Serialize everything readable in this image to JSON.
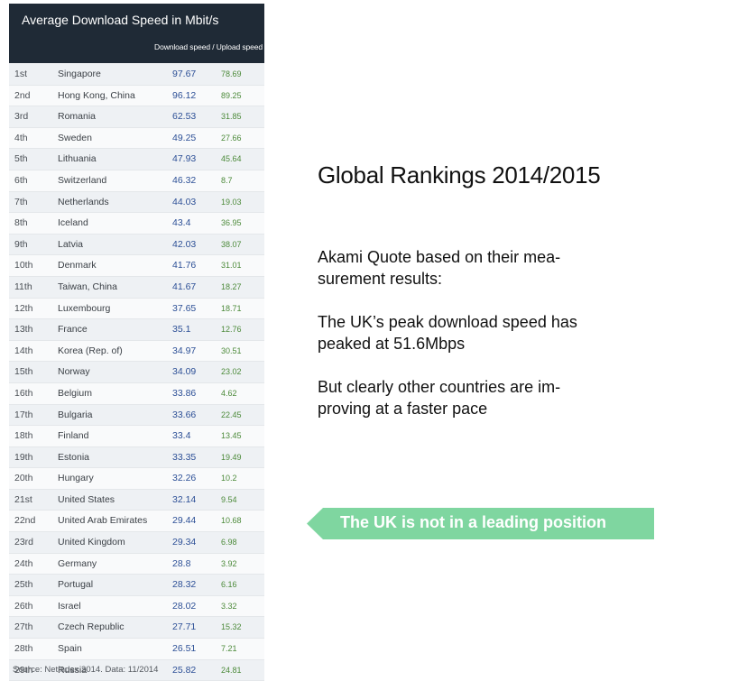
{
  "table": {
    "title": "Average Download Speed in Mbit/s",
    "column_header": "Download speed / Upload speed",
    "rows": [
      {
        "rank": "1st",
        "country": "Singapore",
        "download": "97.67",
        "upload": "78.69"
      },
      {
        "rank": "2nd",
        "country": "Hong Kong, China",
        "download": "96.12",
        "upload": "89.25"
      },
      {
        "rank": "3rd",
        "country": "Romania",
        "download": "62.53",
        "upload": "31.85"
      },
      {
        "rank": "4th",
        "country": "Sweden",
        "download": "49.25",
        "upload": "27.66"
      },
      {
        "rank": "5th",
        "country": "Lithuania",
        "download": "47.93",
        "upload": "45.64"
      },
      {
        "rank": "6th",
        "country": "Switzerland",
        "download": "46.32",
        "upload": "8.7"
      },
      {
        "rank": "7th",
        "country": "Netherlands",
        "download": "44.03",
        "upload": "19.03"
      },
      {
        "rank": "8th",
        "country": "Iceland",
        "download": "43.4",
        "upload": "36.95"
      },
      {
        "rank": "9th",
        "country": "Latvia",
        "download": "42.03",
        "upload": "38.07"
      },
      {
        "rank": "10th",
        "country": "Denmark",
        "download": "41.76",
        "upload": "31.01"
      },
      {
        "rank": "11th",
        "country": "Taiwan, China",
        "download": "41.67",
        "upload": "18.27"
      },
      {
        "rank": "12th",
        "country": "Luxembourg",
        "download": "37.65",
        "upload": "18.71"
      },
      {
        "rank": "13th",
        "country": "France",
        "download": "35.1",
        "upload": "12.76"
      },
      {
        "rank": "14th",
        "country": "Korea (Rep. of)",
        "download": "34.97",
        "upload": "30.51"
      },
      {
        "rank": "15th",
        "country": "Norway",
        "download": "34.09",
        "upload": "23.02"
      },
      {
        "rank": "16th",
        "country": "Belgium",
        "download": "33.86",
        "upload": "4.62"
      },
      {
        "rank": "17th",
        "country": "Bulgaria",
        "download": "33.66",
        "upload": "22.45"
      },
      {
        "rank": "18th",
        "country": "Finland",
        "download": "33.4",
        "upload": "13.45"
      },
      {
        "rank": "19th",
        "country": "Estonia",
        "download": "33.35",
        "upload": "19.49"
      },
      {
        "rank": "20th",
        "country": "Hungary",
        "download": "32.26",
        "upload": "10.2"
      },
      {
        "rank": "21st",
        "country": "United States",
        "download": "32.14",
        "upload": "9.54"
      },
      {
        "rank": "22nd",
        "country": "United Arab Emirates",
        "download": "29.44",
        "upload": "10.68"
      },
      {
        "rank": "23rd",
        "country": "United Kingdom",
        "download": "29.34",
        "upload": "6.98"
      },
      {
        "rank": "24th",
        "country": "Germany",
        "download": "28.8",
        "upload": "3.92"
      },
      {
        "rank": "25th",
        "country": "Portugal",
        "download": "28.32",
        "upload": "6.16"
      },
      {
        "rank": "26th",
        "country": "Israel",
        "download": "28.02",
        "upload": "3.32"
      },
      {
        "rank": "27th",
        "country": "Czech Republic",
        "download": "27.71",
        "upload": "15.32"
      },
      {
        "rank": "28th",
        "country": "Spain",
        "download": "26.51",
        "upload": "7.21"
      },
      {
        "rank": "29th",
        "country": "Russia",
        "download": "25.82",
        "upload": "24.81"
      }
    ],
    "source": "Source: NetIndex 2014. Data: 11/2014"
  },
  "heading": "Global Rankings 2014/2015",
  "quote": "Akami Quote based on their mea-\nsurement results:",
  "uk_peak": "The UK’s peak download speed has\npeaked at 51.6Mbps",
  "others": "But clearly other countries are im-\nproving at a faster pace",
  "callout": {
    "text": "The UK is not in a leading position",
    "color": "#7fd6a0"
  },
  "colors": {
    "header_bg": "#1f2a36",
    "download": "#2c4f96",
    "upload": "#4c8a3a"
  }
}
